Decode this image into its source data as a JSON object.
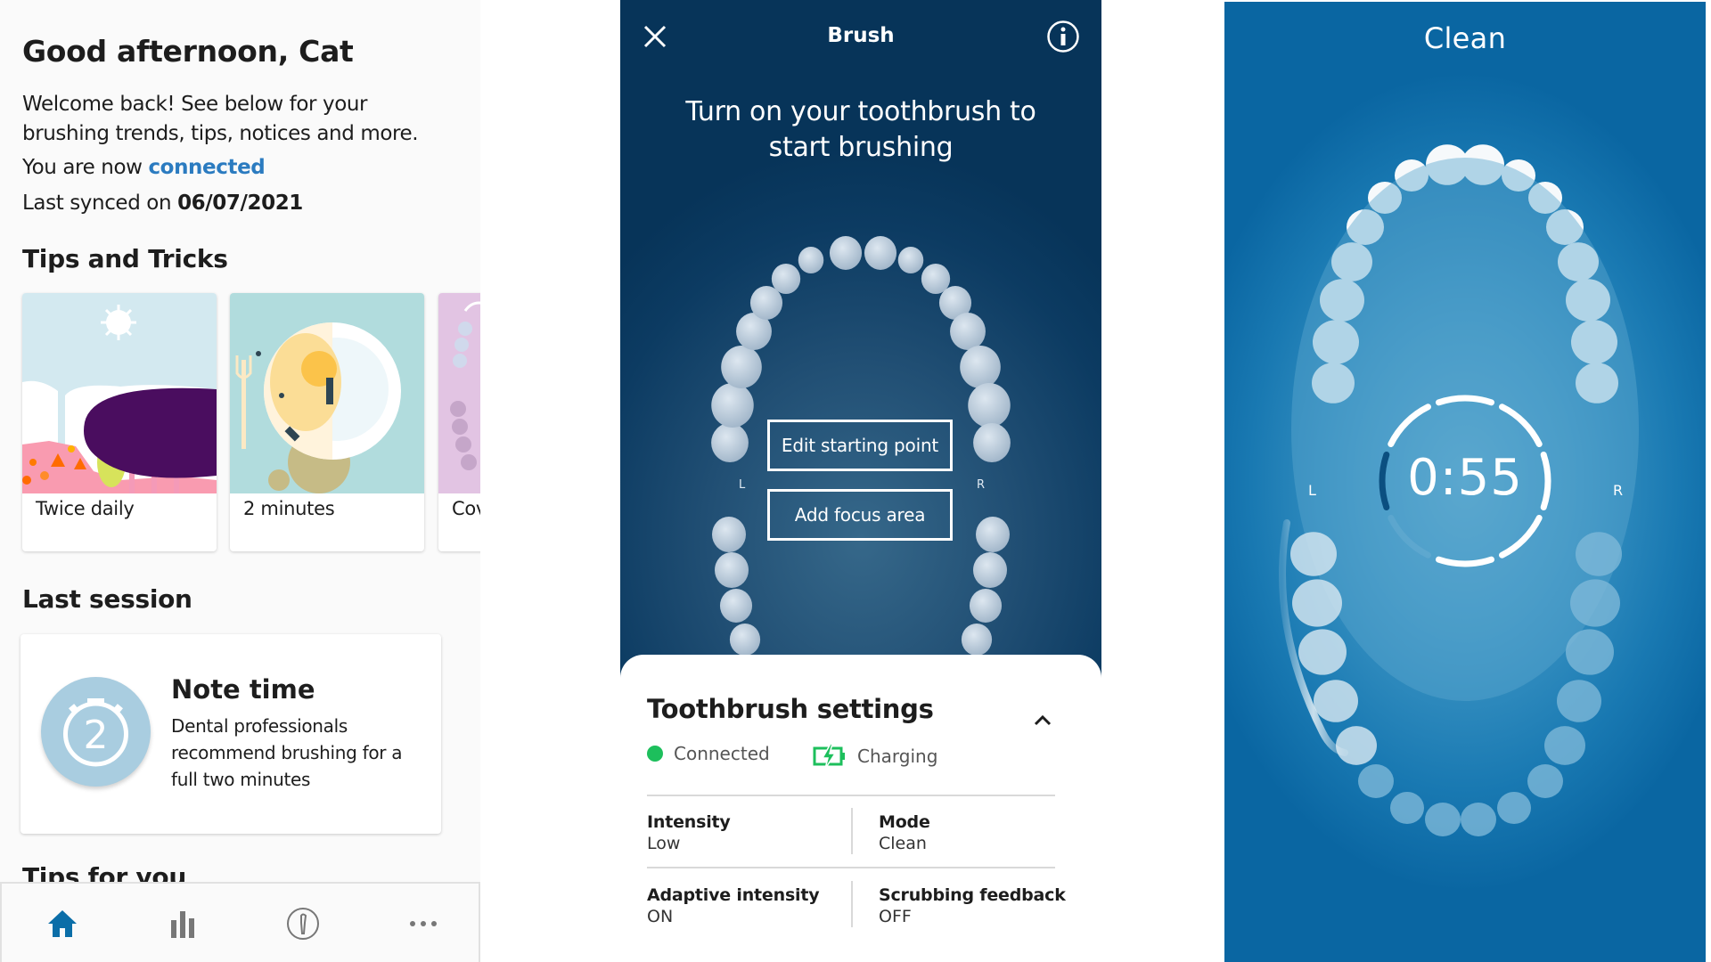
{
  "home": {
    "greeting": "Good afternoon, Cat",
    "welcome": "Welcome back! See below for your brushing trends, tips, notices and more.",
    "connection_prefix": "You are now",
    "connection_status": "connected",
    "last_synced_prefix": "Last synced on",
    "last_synced_date": "06/07/2021",
    "tips_heading": "Tips and Tricks",
    "tips": [
      {
        "label": "Twice daily"
      },
      {
        "label": "2 minutes"
      },
      {
        "label": "Cov"
      }
    ],
    "last_session_heading": "Last session",
    "session_card": {
      "timer_number": "2",
      "title": "Note time",
      "description": "Dental professionals recommend brushing for a full two minutes"
    },
    "tips_for_you_heading": "Tips for you",
    "bottom_nav": [
      {
        "icon": "home-icon",
        "active": true
      },
      {
        "icon": "bar-chart-icon",
        "active": false
      },
      {
        "icon": "toothbrush-head-icon",
        "active": false
      },
      {
        "icon": "more-icon",
        "active": false
      }
    ],
    "colors": {
      "accent": "#0b6ea8",
      "link": "#2b7bc0"
    }
  },
  "brush": {
    "title": "Brush",
    "prompt": "Turn on your toothbrush to start brushing",
    "left_label": "L",
    "right_label": "R",
    "edit_starting_point": "Edit starting point",
    "add_focus_area": "Add focus area",
    "settings": {
      "title": "Toothbrush settings",
      "connected": "Connected",
      "charging": "Charging",
      "items": [
        {
          "key": "Intensity",
          "value": "Low"
        },
        {
          "key": "Mode",
          "value": "Clean"
        },
        {
          "key": "Adaptive intensity",
          "value": "ON"
        },
        {
          "key": "Scrubbing feedback",
          "value": "OFF"
        }
      ],
      "status_color": "#1dbf5c"
    }
  },
  "clean": {
    "mode": "Clean",
    "timer": "0:55",
    "left_label": "L",
    "right_label": "R",
    "segments_completed": 6,
    "segments_total": 8,
    "active_segment_progress": 1.0
  }
}
